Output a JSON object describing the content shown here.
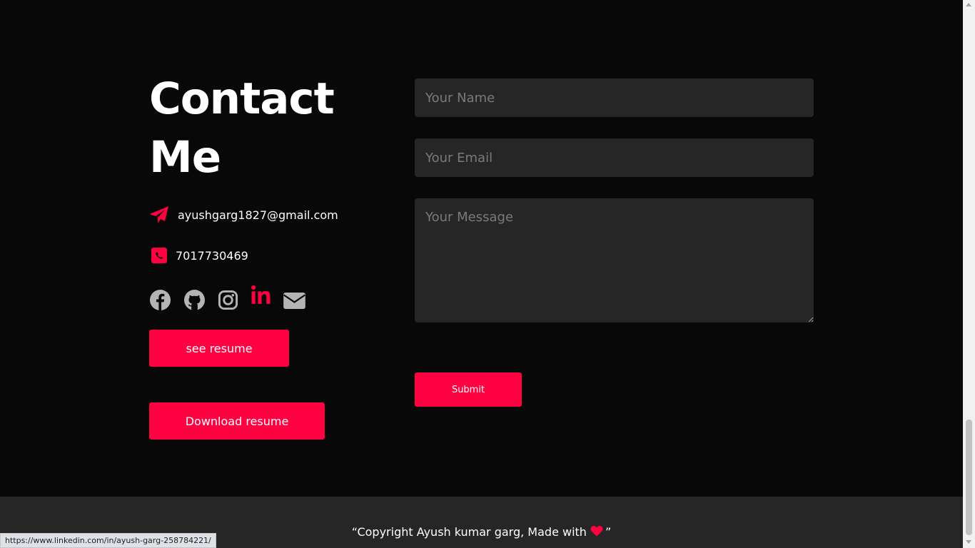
{
  "contact": {
    "title_line1": "Contact",
    "title_line2": "Me",
    "email": "ayushgarg1827@gmail.com",
    "phone": "7017730469",
    "email_icon": "paper-plane-icon",
    "phone_icon": "phone-square-icon"
  },
  "socials": [
    {
      "name": "facebook",
      "icon": "facebook-icon"
    },
    {
      "name": "github",
      "icon": "github-icon"
    },
    {
      "name": "instagram",
      "icon": "instagram-icon"
    },
    {
      "name": "linkedin",
      "icon": "linkedin-icon"
    },
    {
      "name": "email",
      "icon": "envelope-icon"
    }
  ],
  "buttons": {
    "see_resume": "see resume",
    "download_resume": "Download resume",
    "submit": "Submit"
  },
  "form": {
    "name_placeholder": "Your Name",
    "email_placeholder": "Your Email",
    "message_placeholder": "Your Message",
    "name_value": "",
    "email_value": "",
    "message_value": ""
  },
  "footer": {
    "text_before": "“Copyright Ayush kumar garg, Made with",
    "text_after": "”"
  },
  "status_bar": {
    "url": "https://www.linkedin.com/in/ayush-garg-258784221/"
  },
  "colors": {
    "background": "#080808",
    "accent": "#ff0040",
    "field_bg": "#262626",
    "footer_bg": "#262626",
    "icon_gray": "#b4b4b4"
  }
}
